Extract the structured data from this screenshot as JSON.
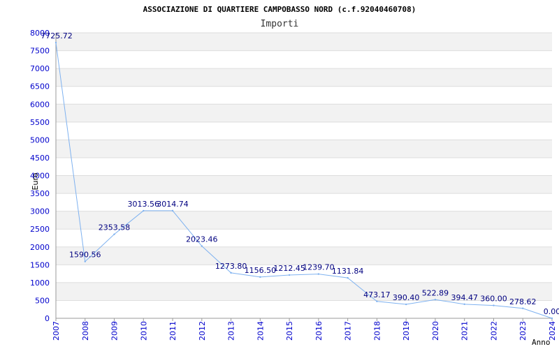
{
  "chart_data": {
    "type": "line",
    "title": "ASSOCIAZIONE DI QUARTIERE CAMPOBASSO NORD (c.f.92040460708)",
    "subtitle": "Importi",
    "xlabel": "Anno",
    "ylabel": "Euro",
    "x": [
      "2007",
      "2008",
      "2009",
      "2010",
      "2011",
      "2012",
      "2013",
      "2014",
      "2015",
      "2016",
      "2017",
      "2018",
      "2019",
      "2020",
      "2021",
      "2022",
      "2023",
      "2024"
    ],
    "values": [
      7725.72,
      1590.56,
      2353.58,
      3013.56,
      3014.74,
      2023.46,
      1273.8,
      1156.5,
      1212.45,
      1239.7,
      1131.84,
      473.17,
      390.4,
      522.89,
      394.47,
      360.0,
      278.62,
      0.0
    ],
    "value_labels": [
      "7725.72",
      "1590.56",
      "2353.58",
      "3013.56",
      "3014.74",
      "2023.46",
      "1273.80",
      "1156.50",
      "1212.45",
      "1239.70",
      "1131.84",
      "473.17",
      "390.40",
      "522.89",
      "394.47",
      "360.00",
      "278.62",
      "0.00"
    ],
    "ylim": [
      0,
      8000
    ],
    "yticks": [
      "0",
      "500",
      "1000",
      "1500",
      "2000",
      "2500",
      "3000",
      "3500",
      "4000",
      "4500",
      "5000",
      "5500",
      "6000",
      "6500",
      "7000",
      "7500",
      "8000"
    ],
    "grid": true,
    "colors": {
      "line": "#7fb2f0",
      "labels": "#000080",
      "ticks": "#0000cc",
      "band": "#f2f2f2",
      "grid": "#dddddd"
    }
  }
}
